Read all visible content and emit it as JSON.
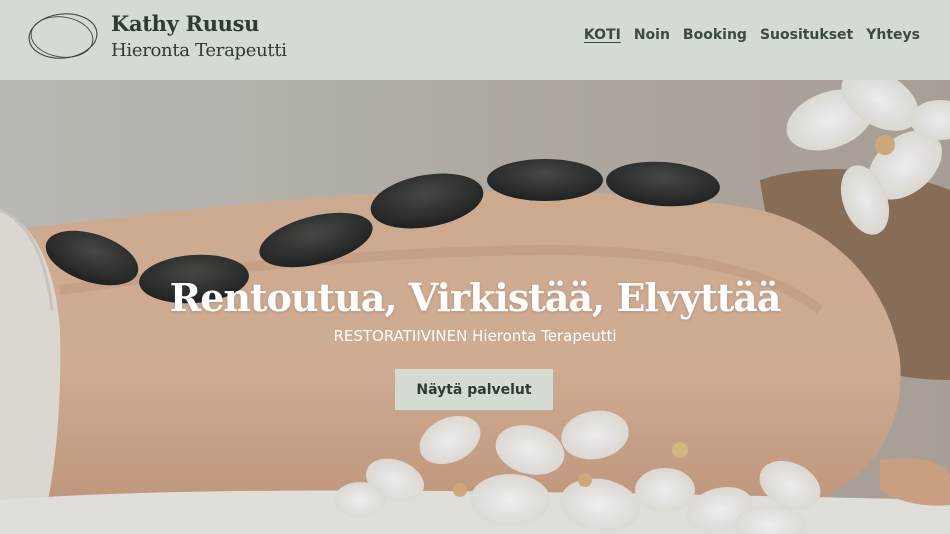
{
  "brand": {
    "name": "Kathy Ruusu",
    "subtitle": "Hieronta Terapeutti",
    "logo_icon": "ellipse-logo-icon"
  },
  "nav": {
    "items": [
      {
        "label": "KOTI",
        "active": true
      },
      {
        "label": "Noin",
        "active": false
      },
      {
        "label": "Booking",
        "active": false
      },
      {
        "label": "Suositukset",
        "active": false
      },
      {
        "label": "Yhteys",
        "active": false
      }
    ]
  },
  "hero": {
    "title": "Rentoutua, Virkistää, Elvyttää",
    "subtitle": "RESTORATIIVINEN Hieronta Terapeutti",
    "button_label": "Näytä palvelut"
  },
  "colors": {
    "header_bg": "#d3dbd3",
    "text_dark": "#2f3a33",
    "button_bg": "#d3dbd3"
  }
}
